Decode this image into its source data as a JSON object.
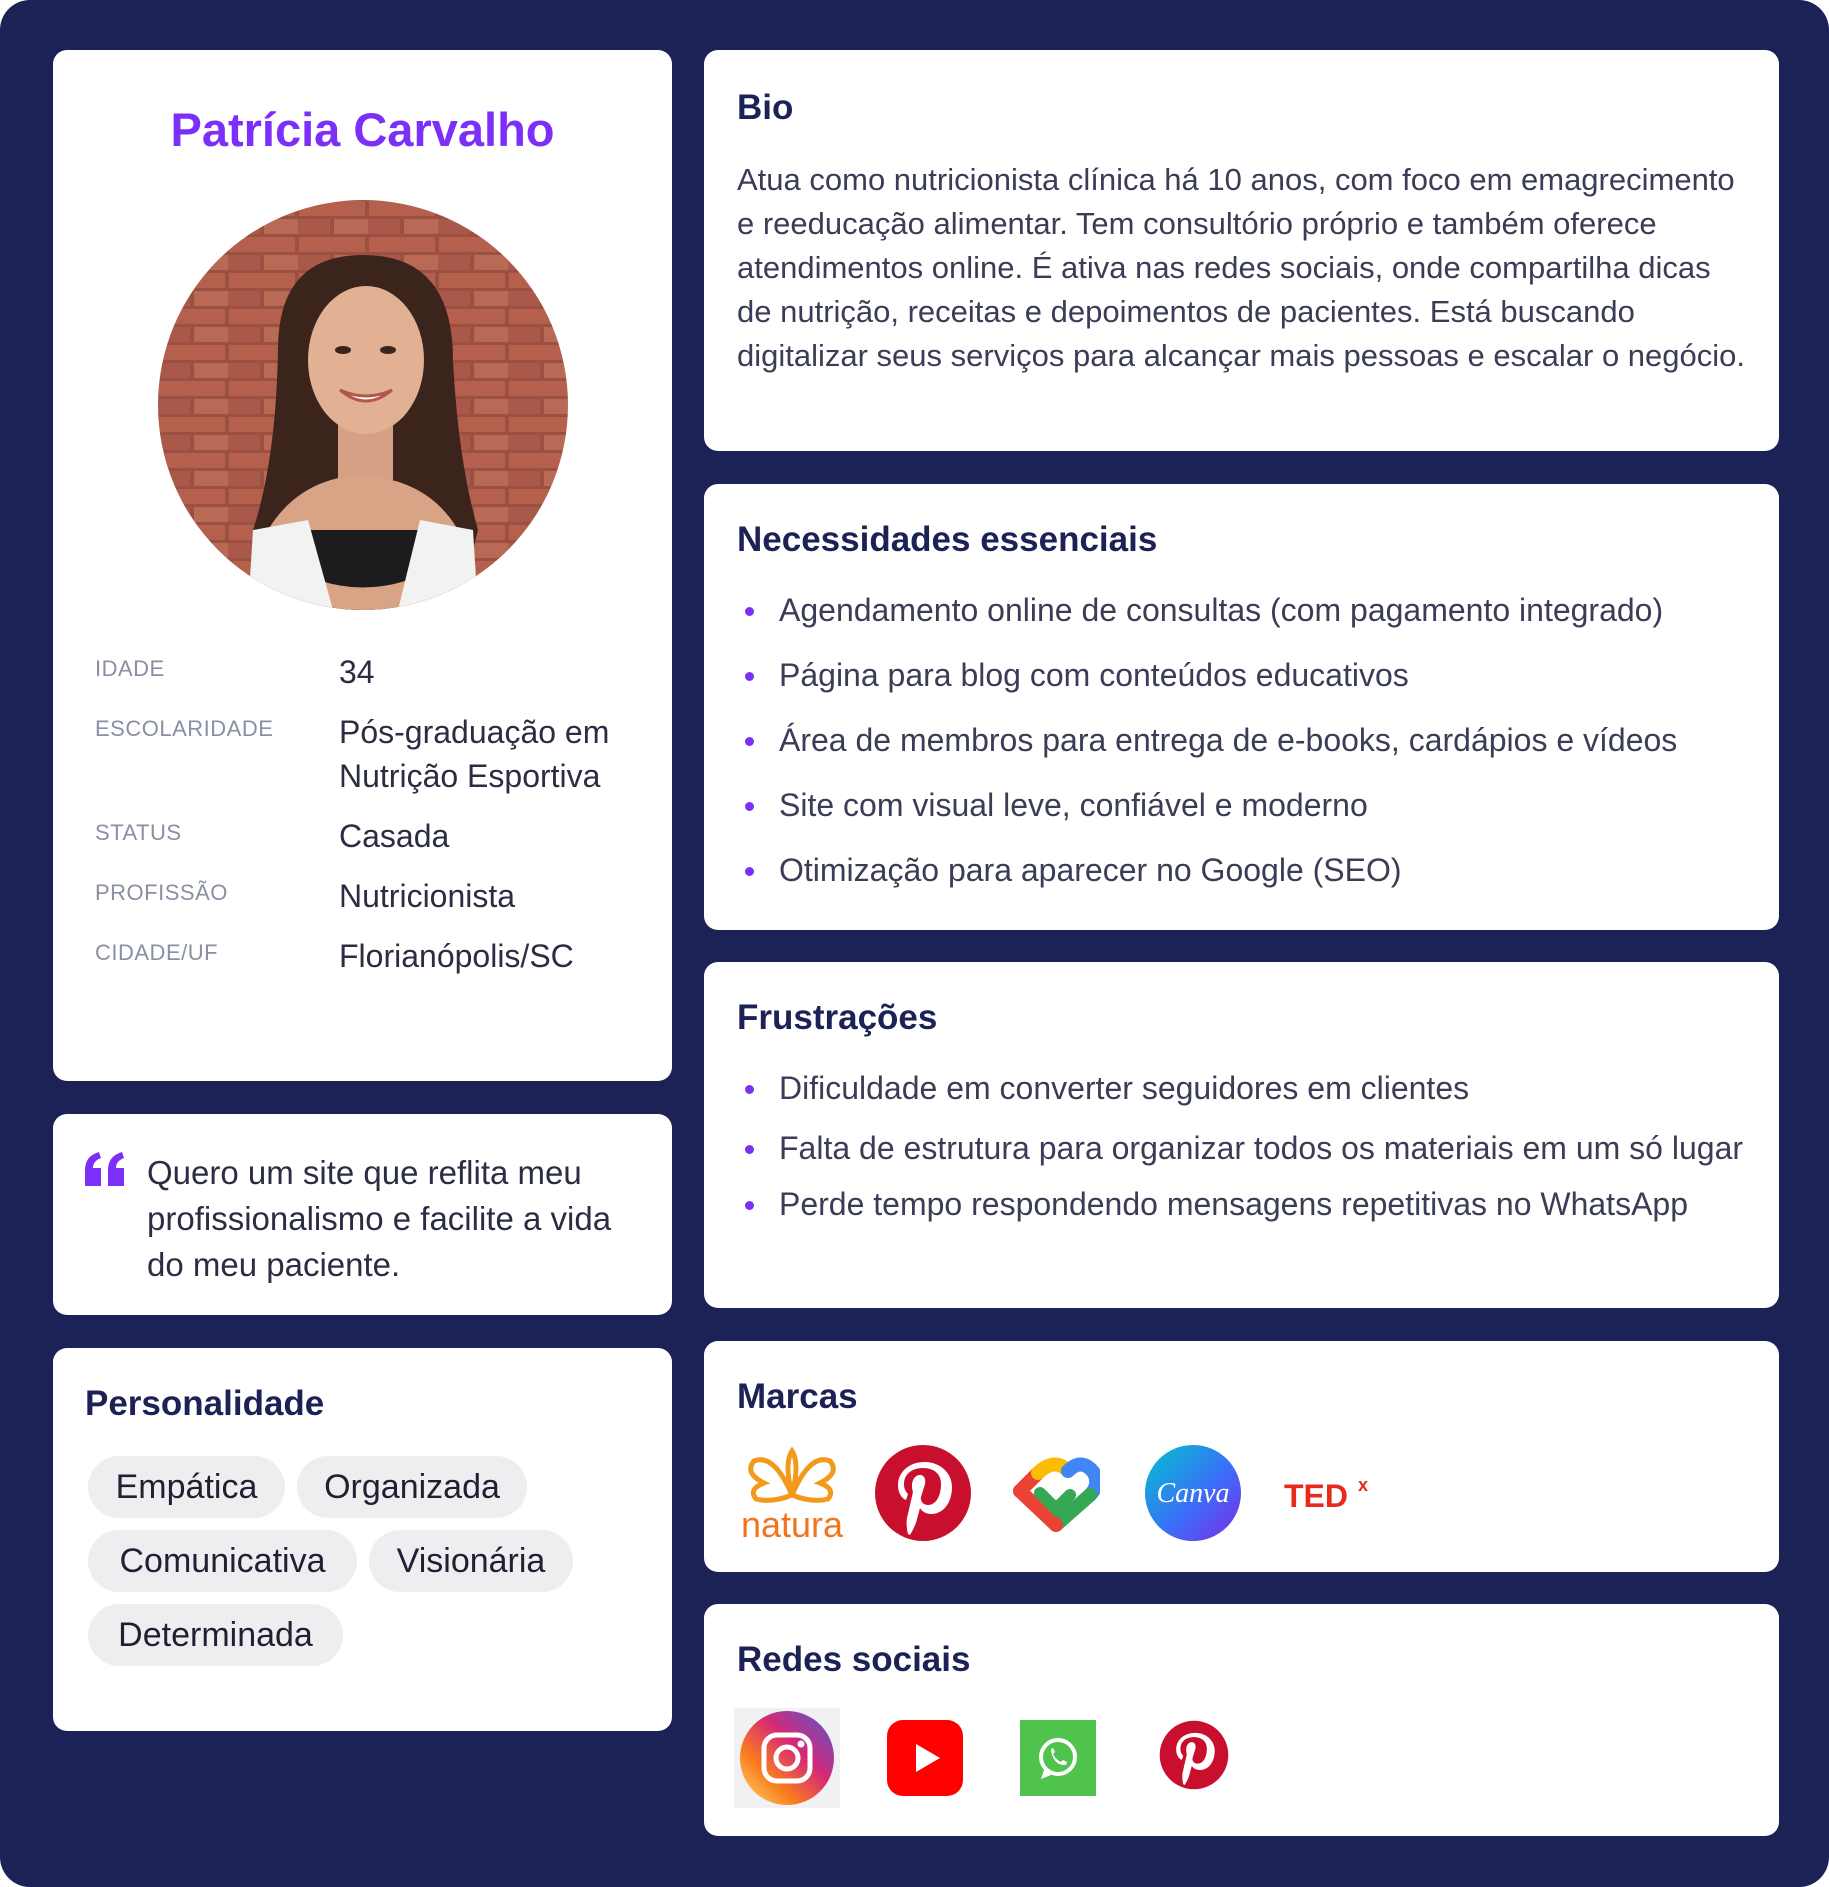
{
  "profile": {
    "name": "Patrícia Carvalho",
    "fields": [
      {
        "label": "IDADE",
        "value": "34"
      },
      {
        "label": "ESCOLARIDADE",
        "value": "Pós-graduação em Nutrição Esportiva"
      },
      {
        "label": "STATUS",
        "value": "Casada"
      },
      {
        "label": "PROFISSÃO",
        "value": "Nutricionista"
      },
      {
        "label": "CIDADE/UF",
        "value": "Florianópolis/SC"
      }
    ]
  },
  "quote": {
    "text": "Quero um site que reflita meu profissionalismo e facilite a vida do meu paciente."
  },
  "personality": {
    "title": "Personalidade",
    "traits": [
      "Empática",
      "Organizada",
      "Comunicativa",
      "Visionária",
      "Determinada"
    ]
  },
  "bio": {
    "title": "Bio",
    "text": "Atua como nutricionista clínica há 10 anos, com foco em emagrecimento e reeducação alimentar. Tem consultório próprio e também oferece atendimentos online. É ativa nas redes sociais, onde compartilha dicas de nutrição, receitas e depoimentos de pacientes. Está buscando digitalizar seus serviços para alcançar mais pessoas e escalar o negócio."
  },
  "needs": {
    "title": "Necessidades essenciais",
    "items": [
      "Agendamento online de consultas (com pagamento integrado)",
      "Página para blog com conteúdos educativos",
      "Área de membros para entrega de e-books, cardápios e vídeos",
      "Site com visual leve, confiável e moderno",
      "Otimização para aparecer no Google (SEO)"
    ]
  },
  "frustrations": {
    "title": "Frustrações",
    "items": [
      "Dificuldade em converter seguidores em clientes",
      "Falta de estrutura para organizar todos os materiais em um só lugar",
      "Perde tempo respondendo mensagens repetitivas no WhatsApp"
    ]
  },
  "brands": {
    "title": "Marcas",
    "logos": [
      "natura-logo",
      "pinterest-logo",
      "google-fit-logo",
      "canva-logo",
      "tedx-logo"
    ],
    "natura_wordmark": "natura",
    "canva_wordmark": "Canva",
    "tedx_wordmark": "TED",
    "tedx_sup": "x"
  },
  "socials": {
    "title": "Redes sociais",
    "icons": [
      "instagram-icon",
      "youtube-icon",
      "whatsapp-icon",
      "pinterest-icon"
    ]
  },
  "colors": {
    "background": "#1c2156",
    "accent": "#7b2ff7",
    "card": "#ffffff",
    "chip": "#eeeef1"
  }
}
